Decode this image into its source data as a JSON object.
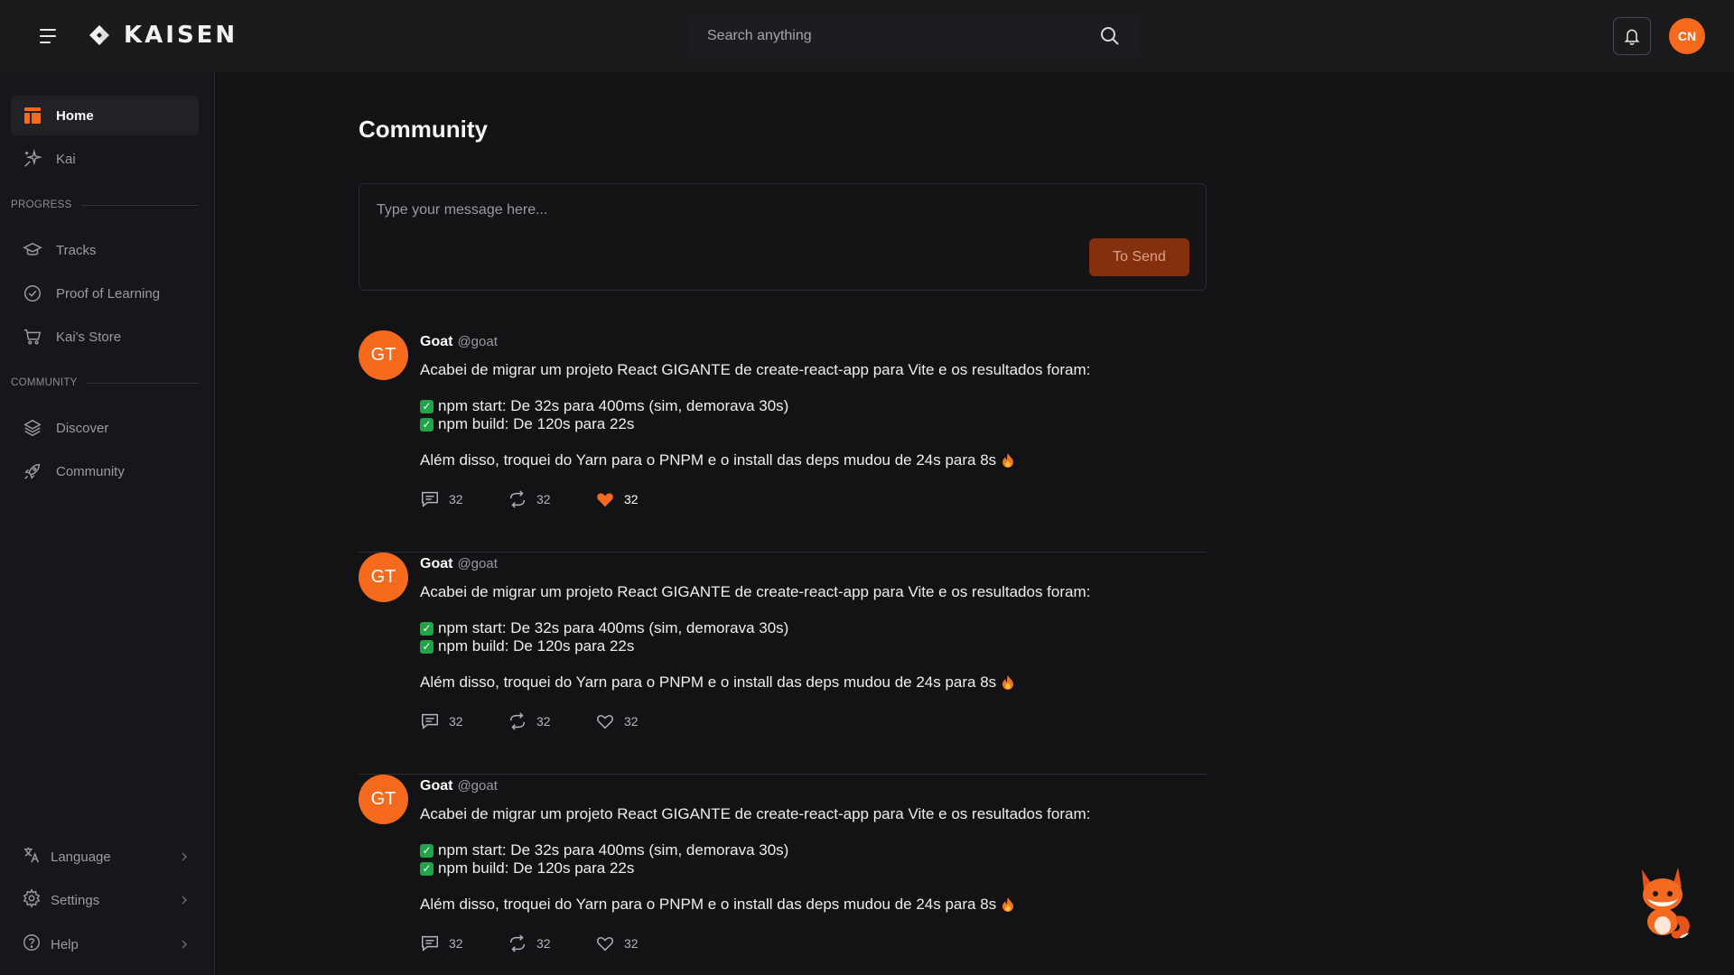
{
  "header": {
    "brand": "KAISEN",
    "search_placeholder": "Search anything",
    "user_initials": "CN"
  },
  "sidebar": {
    "items": [
      {
        "label": "Home"
      },
      {
        "label": "Kai"
      }
    ],
    "progress_label": "PROGRESS",
    "progress_items": [
      {
        "label": "Tracks"
      },
      {
        "label": "Proof of Learning"
      },
      {
        "label": "Kai's Store"
      }
    ],
    "community_label": "COMMUNITY",
    "community_items": [
      {
        "label": "Discover"
      },
      {
        "label": "Community"
      }
    ],
    "bottom_items": [
      {
        "label": "Language"
      },
      {
        "label": "Settings"
      },
      {
        "label": "Help"
      }
    ]
  },
  "main": {
    "title": "Community",
    "composer_placeholder": "Type your message here...",
    "send_label": "To Send"
  },
  "posts": [
    {
      "initials": "GT",
      "name": "Goat",
      "handle": "@goat",
      "line1": "Acabei de migrar um projeto React GIGANTE de create-react-app para Vite e os resultados foram:",
      "check1": "npm start: De 32s para 400ms (sim, demorava 30s)",
      "check2": "npm build: De 120s para 22s",
      "line4": "Além disso, troquei do Yarn para o PNPM e o install das deps mudou de 24s para 8s",
      "comments": "32",
      "reposts": "32",
      "likes": "32",
      "liked": true
    },
    {
      "initials": "GT",
      "name": "Goat",
      "handle": "@goat",
      "line1": "Acabei de migrar um projeto React GIGANTE de create-react-app para Vite e os resultados foram:",
      "check1": "npm start: De 32s para 400ms (sim, demorava 30s)",
      "check2": "npm build: De 120s para 22s",
      "line4": "Além disso, troquei do Yarn para o PNPM e o install das deps mudou de 24s para 8s",
      "comments": "32",
      "reposts": "32",
      "likes": "32",
      "liked": false
    },
    {
      "initials": "GT",
      "name": "Goat",
      "handle": "@goat",
      "line1": "Acabei de migrar um projeto React GIGANTE de create-react-app para Vite e os resultados foram:",
      "check1": "npm start: De 32s para 400ms (sim, demorava 30s)",
      "check2": "npm build: De 120s para 22s",
      "line4": "Além disso, troquei do Yarn para o PNPM e o install das deps mudou de 24s para 8s",
      "comments": "32",
      "reposts": "32",
      "likes": "32",
      "liked": false
    }
  ],
  "colors": {
    "accent": "#f56a1d",
    "send_button": "#84300e",
    "background": "#131215",
    "header": "#1b1a1d"
  }
}
